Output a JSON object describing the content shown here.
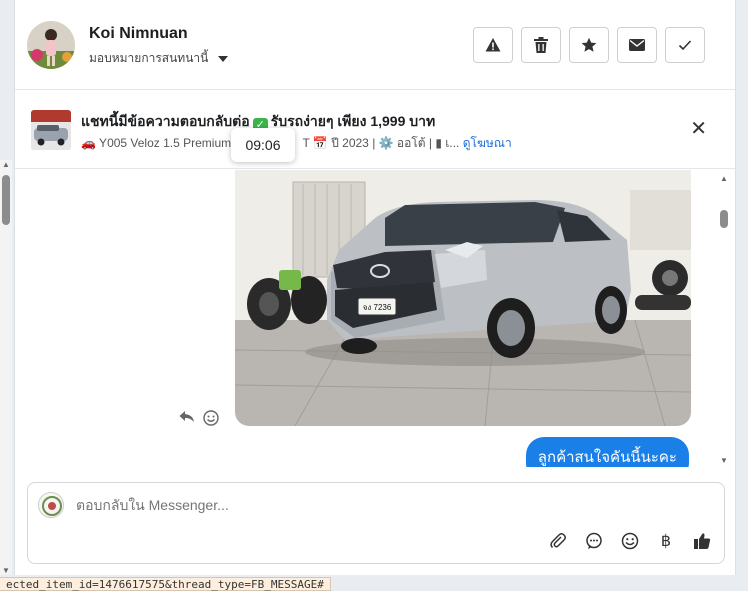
{
  "header": {
    "name": "Koi Nimnuan",
    "assign_label": "มอบหมายการสนทนานี้",
    "buttons": [
      {
        "name": "report-spam-button",
        "icon": "warning-icon"
      },
      {
        "name": "delete-button",
        "icon": "trash-icon"
      },
      {
        "name": "star-button",
        "icon": "star-icon"
      },
      {
        "name": "mark-unread-button",
        "icon": "envelope-icon"
      },
      {
        "name": "mark-done-button",
        "icon": "check-icon"
      }
    ]
  },
  "ad": {
    "title_part1": "แชทนี้มีข้อความตอบกลับต่อ",
    "title_check": "✓",
    "title_part2": "รับรถง่ายๆ เพียง 1,999 บาท",
    "subtitle_part1": "🚗 Y005 Veloz 1.5 Premium",
    "subtitle_part2": "T 📅 ปี 2023 | ⚙️ ออโต้ | ▮ เ...",
    "link": "ดูโฆษณา"
  },
  "tooltip_time": "09:06",
  "messages": {
    "outgoing_text": "ลูกค้าสนใจคันนี้นะคะ",
    "car_plate": "จง 7236"
  },
  "composer": {
    "placeholder": "ตอบกลับใน Messenger...",
    "currency_symbol": "฿"
  },
  "status_url": "ected_item_id=1476617575&thread_type=FB_MESSAGE#",
  "colors": {
    "accent": "#1a7fe6",
    "done_check": "#3bb54a"
  }
}
